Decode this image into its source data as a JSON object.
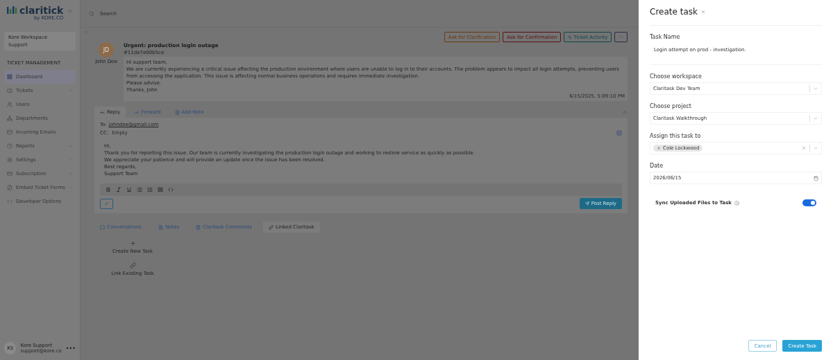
{
  "sidebar": {
    "logo": "claritick",
    "logo_by": "by KORE.CO",
    "workspace": {
      "name": "Kore Workspace",
      "role": "Support"
    },
    "section": "TICKET MANAGEMENT",
    "items": [
      {
        "label": "Dashboard",
        "selected": true,
        "expandable": false
      },
      {
        "label": "Tickets",
        "selected": false,
        "expandable": true
      },
      {
        "label": "Users",
        "selected": false,
        "expandable": false
      },
      {
        "label": "Departments",
        "selected": false,
        "expandable": false
      },
      {
        "label": "Incoming Emails",
        "selected": false,
        "expandable": false
      },
      {
        "label": "Reports",
        "selected": false,
        "expandable": true
      },
      {
        "label": "Settings",
        "selected": false,
        "expandable": true
      },
      {
        "label": "Subscription",
        "selected": false,
        "expandable": true
      },
      {
        "label": "Embed Ticket Forms",
        "selected": false,
        "expandable": true
      },
      {
        "label": "Developer Options",
        "selected": false,
        "expandable": false
      }
    ],
    "user": {
      "initials": "KS",
      "name": "Kore Support",
      "email": "support@kore.co",
      "more": "•••"
    }
  },
  "search": {
    "placeholder": "Search"
  },
  "ticket": {
    "actions": [
      {
        "label": "Ask for Clarification",
        "kind": "clarify"
      },
      {
        "label": "Ask for Confirmation",
        "kind": "confirm"
      },
      {
        "label": "Ticket Activity",
        "kind": "activity"
      },
      {
        "label": "···",
        "kind": "more"
      }
    ],
    "title": "Urgent: production login outage",
    "id": "#11de7e00b5ce",
    "avatar": "JD",
    "author": "John Doe",
    "body": [
      "Hi support team,",
      "We are currently experiencing a critical issue affecting the production environment where users are unable to log in to their accounts. The problem appears to impact all login attempts, preventing users from accessing the application. This issue is affecting normal business operations and requires immediate investigation.",
      "Please advise.",
      "Thanks, John"
    ],
    "timestamp": "6/15/2025, 5:09:10 PM"
  },
  "reply": {
    "tabs": [
      {
        "label": "Reply",
        "selected": true
      },
      {
        "label": "Forward",
        "selected": false
      },
      {
        "label": "Add Note",
        "selected": false
      }
    ],
    "to_label": "To:",
    "to": "johndoe@gmail.com",
    "cc_label": "CC:",
    "cc_placeholder": "Empty",
    "body": [
      "Hi,",
      "Thank you for reporting this issue. Our team is currently investigating the production login outage and working to restore service as quickly as possible.",
      "We appreciate your patience and will provide an update once the issue has been resolved.",
      "Best regards,",
      "Support Team"
    ],
    "post": "Post Reply"
  },
  "bottom_tabs": [
    {
      "label": "Conversations",
      "selected": false
    },
    {
      "label": "Notes",
      "selected": false
    },
    {
      "label": "Claritask Comments",
      "selected": false
    },
    {
      "label": "Linked Claritask",
      "selected": true
    }
  ],
  "linked_actions": [
    {
      "label": "Create New Task",
      "kind": "create"
    },
    {
      "label": "Link Existing Task",
      "kind": "link"
    }
  ],
  "drawer": {
    "title": "Create task",
    "fields": [
      {
        "kind": "text",
        "label": "Task Name",
        "value": "Login attempt on prod - investigation."
      },
      {
        "kind": "select",
        "label": "Choose workspace",
        "value": "Claritask Dev Team"
      },
      {
        "kind": "select",
        "label": "Choose project",
        "value": "Claritask Walkthrough"
      },
      {
        "kind": "tags",
        "label": "Assign this task to",
        "tags": [
          "Cole Lockwood"
        ]
      },
      {
        "kind": "date",
        "label": "Date",
        "value": "2026/06/15"
      }
    ],
    "sync": {
      "label": "Sync Uploaded Files to Task",
      "on": true
    },
    "cancel": "Cancel",
    "submit": "Create Task"
  }
}
